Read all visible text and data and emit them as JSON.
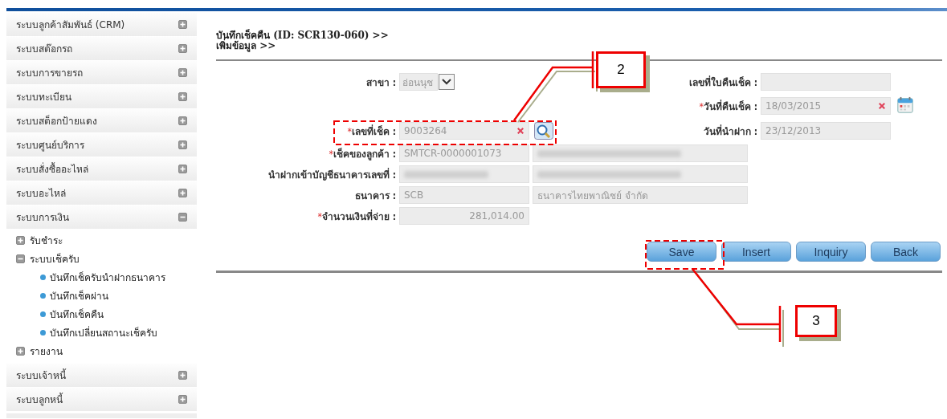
{
  "sidebar": {
    "items": [
      {
        "label": "ระบบลูกค้าสัมพันธ์ (CRM)",
        "expanded": false
      },
      {
        "label": "ระบบสต๊อกรถ",
        "expanded": false
      },
      {
        "label": "ระบบการขายรถ",
        "expanded": false
      },
      {
        "label": "ระบบทะเบียน",
        "expanded": false
      },
      {
        "label": "ระบบสต็อกป้ายแดง",
        "expanded": false
      },
      {
        "label": "ระบบศูนย์บริการ",
        "expanded": false
      },
      {
        "label": "ระบบสั่งซื้ออะไหล่",
        "expanded": false
      },
      {
        "label": "ระบบอะไหล่",
        "expanded": false
      },
      {
        "label": "ระบบการเงิน",
        "expanded": true,
        "children": [
          {
            "label": "รับชำระ",
            "expanded": false
          },
          {
            "label": "ระบบเช็ครับ",
            "expanded": true,
            "children": [
              {
                "label": "บันทึกเช็ครับนำฝากธนาคาร"
              },
              {
                "label": "บันทึกเช็คผ่าน"
              },
              {
                "label": "บันทึกเช็คคืน"
              },
              {
                "label": "บันทึกเปลี่ยนสถานะเช็ครับ"
              }
            ]
          },
          {
            "label": "รายงาน",
            "expanded": false
          }
        ]
      },
      {
        "label": "ระบบเจ้าหนี้",
        "expanded": false
      },
      {
        "label": "ระบบลูกหนี้",
        "expanded": false
      }
    ]
  },
  "page_header": {
    "title": "บันทึกเช็คคืน (ID: SCR130-060) >>",
    "subtitle": "เพิ่มข้อมูล >>"
  },
  "form": {
    "branch": {
      "label": "สาขา :",
      "value": "อ่อนนุช"
    },
    "return_slip_no": {
      "label": "เลขที่ใบคืนเช็ค :"
    },
    "return_date": {
      "mark": "*",
      "label": "วันที่คืนเช็ค :",
      "value": "18/03/2015"
    },
    "cheque_no": {
      "mark": "*",
      "label": "เลขที่เช็ค :",
      "value": "9003264"
    },
    "deposit_date": {
      "label": "วันที่นำฝาก :",
      "value": "23/12/2013"
    },
    "customer_cheque": {
      "mark": "*",
      "label": "เช็คของลูกค้า :",
      "value": "SMTCR-0000001073",
      "second_redacted": true
    },
    "bank_account": {
      "label": "นำฝากเข้าบัญชีธนาคารเลขที่ :",
      "redacted": true,
      "second_redacted": true
    },
    "bank": {
      "label": "ธนาคาร :",
      "value": "SCB",
      "second_value": "ธนาคารไทยพาณิชย์ จำกัด"
    },
    "amount": {
      "mark": "*",
      "label": "จำนวนเงินที่จ่าย :",
      "value": "281,014.00"
    }
  },
  "buttons": [
    "Save",
    "Insert",
    "Inquiry",
    "Back"
  ],
  "callouts": [
    {
      "number": "2"
    },
    {
      "number": "3"
    }
  ]
}
